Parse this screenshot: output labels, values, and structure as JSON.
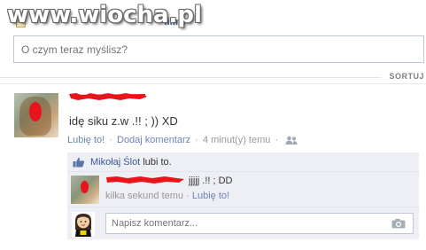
{
  "watermark": {
    "text": "www.wiocha.pl"
  },
  "composer": {
    "tab_label": "filmy",
    "placeholder": "O czym teraz myślisz?"
  },
  "sort": {
    "label": "SORTUJ"
  },
  "story": {
    "text": "idę siku z.w .!! ; )) XD",
    "actions": {
      "like": "Lubię to!",
      "separator": "·",
      "comment": "Dodaj komentarz",
      "time": "4 minut(y) temu"
    }
  },
  "feedback": {
    "liker": "Mikołaj Ślot",
    "likes_suffix": "lubi to.",
    "comment": {
      "text": "jjjjj .!! ; DD",
      "time": "kilka sekund temu",
      "separator": "·",
      "like": "Lubię to!"
    },
    "reply_placeholder": "Napisz komentarz..."
  },
  "colors": {
    "link": "#3b5998",
    "link_light": "#6d84b4",
    "scribble": "#e8141c",
    "feedback_bg": "#edeff4",
    "input_border": "#bdc7d8"
  },
  "icons": {
    "composer": "photo-tab-icon",
    "friends": "friends-icon",
    "like": "thumbs-up-icon",
    "camera": "camera-icon"
  }
}
